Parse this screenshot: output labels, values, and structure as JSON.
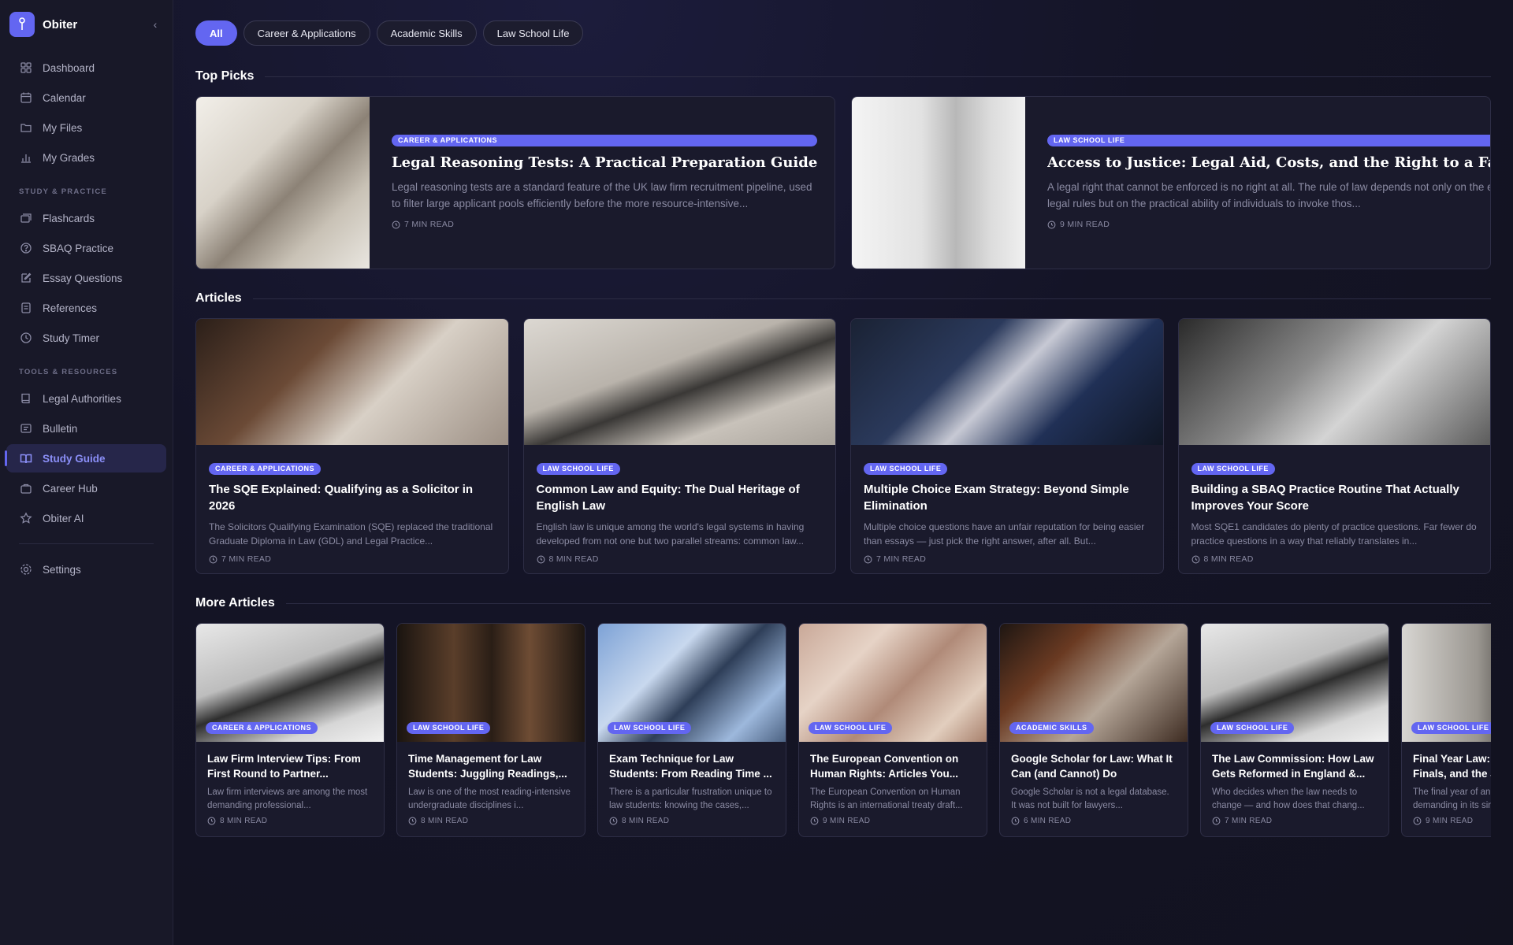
{
  "app": {
    "name": "Obiter"
  },
  "sidebar": {
    "items_main": [
      {
        "label": "Dashboard",
        "icon": "grid-icon"
      },
      {
        "label": "Calendar",
        "icon": "calendar-icon"
      },
      {
        "label": "My Files",
        "icon": "folder-icon"
      },
      {
        "label": "My Grades",
        "icon": "bar-chart-icon"
      }
    ],
    "section_study": "STUDY & PRACTICE",
    "items_study": [
      {
        "label": "Flashcards",
        "icon": "cards-icon"
      },
      {
        "label": "SBAQ Practice",
        "icon": "question-icon"
      },
      {
        "label": "Essay Questions",
        "icon": "pencil-icon"
      },
      {
        "label": "References",
        "icon": "document-icon"
      },
      {
        "label": "Study Timer",
        "icon": "clock-icon"
      }
    ],
    "section_tools": "TOOLS & RESOURCES",
    "items_tools": [
      {
        "label": "Legal Authorities",
        "icon": "book-icon"
      },
      {
        "label": "Bulletin",
        "icon": "message-icon"
      },
      {
        "label": "Study Guide",
        "icon": "open-book-icon",
        "active": true
      },
      {
        "label": "Career Hub",
        "icon": "briefcase-icon"
      },
      {
        "label": "Obiter AI",
        "icon": "star-icon"
      }
    ],
    "settings": {
      "label": "Settings",
      "icon": "gear-icon"
    }
  },
  "filters": [
    "All",
    "Career & Applications",
    "Academic Skills",
    "Law School Life"
  ],
  "sections": {
    "top": "Top Picks",
    "articles": "Articles",
    "more": "More Articles"
  },
  "top_picks": [
    {
      "tag": "CAREER & APPLICATIONS",
      "title": "Legal Reasoning Tests: A Practical Preparation Guide",
      "excerpt": "Legal reasoning tests are a standard feature of the UK law firm recruitment pipeline, used to filter large applicant pools efficiently before the more resource-intensive...",
      "read": "7 MIN READ"
    },
    {
      "tag": "LAW SCHOOL LIFE",
      "title": "Access to Justice: Legal Aid, Costs, and the Right to a Fair Trial",
      "excerpt": "A legal right that cannot be enforced is no right at all. The rule of law depends not only on the existence of legal rules but on the practical ability of individuals to invoke thos...",
      "read": "9 MIN READ"
    }
  ],
  "articles": [
    {
      "tag": "CAREER & APPLICATIONS",
      "title": "The SQE Explained: Qualifying as a Solicitor in 2026",
      "excerpt": "The Solicitors Qualifying Examination (SQE) replaced the traditional Graduate Diploma in Law (GDL) and Legal Practice...",
      "read": "7 MIN READ"
    },
    {
      "tag": "LAW SCHOOL LIFE",
      "title": "Common Law and Equity: The Dual Heritage of English Law",
      "excerpt": "English law is unique among the world's legal systems in having developed from not one but two parallel streams: common law...",
      "read": "8 MIN READ"
    },
    {
      "tag": "LAW SCHOOL LIFE",
      "title": "Multiple Choice Exam Strategy: Beyond Simple Elimination",
      "excerpt": "Multiple choice questions have an unfair reputation for being easier than essays — just pick the right answer, after all. But...",
      "read": "7 MIN READ"
    },
    {
      "tag": "LAW SCHOOL LIFE",
      "title": "Building a SBAQ Practice Routine That Actually Improves Your Score",
      "excerpt": "Most SQE1 candidates do plenty of practice questions. Far fewer do practice questions in a way that reliably translates in...",
      "read": "8 MIN READ"
    }
  ],
  "more_articles": [
    {
      "tag": "CAREER & APPLICATIONS",
      "title": "Law Firm Interview Tips: From First Round to Partner...",
      "excerpt": "Law firm interviews are among the most demanding professional...",
      "read": "8 MIN READ"
    },
    {
      "tag": "LAW SCHOOL LIFE",
      "title": "Time Management for Law Students: Juggling Readings,...",
      "excerpt": "Law is one of the most reading-intensive undergraduate disciplines i...",
      "read": "8 MIN READ"
    },
    {
      "tag": "LAW SCHOOL LIFE",
      "title": "Exam Technique for Law Students: From Reading Time ...",
      "excerpt": "There is a particular frustration unique to law students: knowing the cases,...",
      "read": "8 MIN READ"
    },
    {
      "tag": "LAW SCHOOL LIFE",
      "title": "The European Convention on Human Rights: Articles You...",
      "excerpt": "The European Convention on Human Rights is an international treaty draft...",
      "read": "9 MIN READ"
    },
    {
      "tag": "ACADEMIC SKILLS",
      "title": "Google Scholar for Law: What It Can (and Cannot) Do",
      "excerpt": "Google Scholar is not a legal database. It was not built for lawyers...",
      "read": "6 MIN READ"
    },
    {
      "tag": "LAW SCHOOL LIFE",
      "title": "The Law Commission: How Law Gets Reformed in England &...",
      "excerpt": "Who decides when the law needs to change — and how does that chang...",
      "read": "7 MIN READ"
    },
    {
      "tag": "LAW SCHOOL LIFE",
      "title": "Final Year Law: Dissertation, Finals, and the Job Hunt",
      "excerpt": "The final year of an LLB is the most demanding in its single...",
      "read": "9 MIN READ"
    }
  ]
}
